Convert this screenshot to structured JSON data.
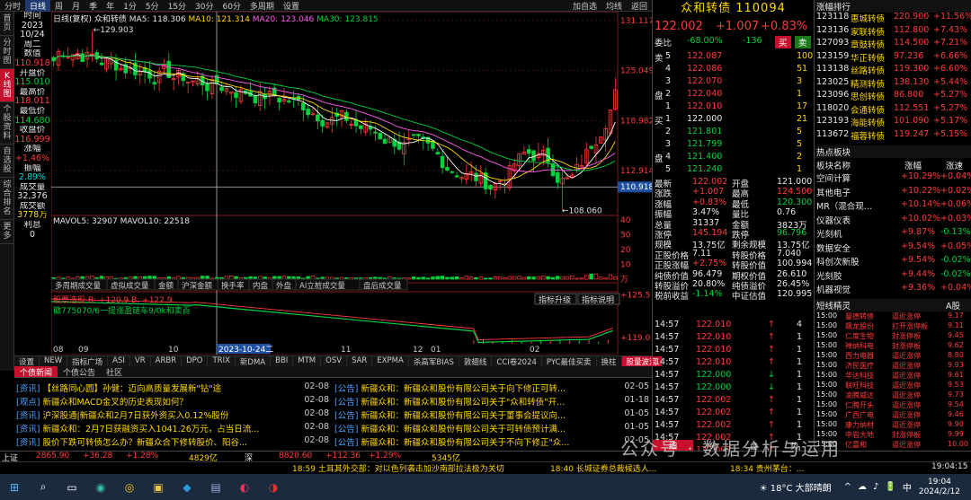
{
  "topbar": {
    "items": [
      "分时",
      "日线",
      "周",
      "月",
      "季",
      "年",
      "1分",
      "5分",
      "15分",
      "30分",
      "60分",
      "多周期",
      "设置"
    ],
    "active": 1,
    "right": [
      "加自选",
      "均线",
      "返回"
    ]
  },
  "lefttabs": [
    "首页",
    "分时图",
    "K线图",
    "个股资料",
    "自选股",
    "综合排名",
    "更多"
  ],
  "lefttab_active": 2,
  "infocol": [
    [
      "时间",
      "wht"
    ],
    [
      "2023",
      "wht"
    ],
    [
      "10/24",
      "wht"
    ],
    [
      "周二",
      "wht"
    ],
    [
      "数值",
      "wht"
    ],
    [
      "110.918",
      "red"
    ],
    [
      "开盘价",
      "wht"
    ],
    [
      "115.010",
      "grn"
    ],
    [
      "最高价",
      "wht"
    ],
    [
      "118.011",
      "red"
    ],
    [
      "最低价",
      "wht"
    ],
    [
      "114.680",
      "grn"
    ],
    [
      "收盘价",
      "wht"
    ],
    [
      "116.999",
      "red"
    ],
    [
      "涨幅",
      "wht"
    ],
    [
      "+1.46%",
      "red"
    ],
    [
      "振幅",
      "wht"
    ],
    [
      "2.89%",
      "cyn"
    ],
    [
      "成交量",
      "wht"
    ],
    [
      "32,376",
      "wht"
    ],
    [
      "成交额",
      "wht"
    ],
    [
      "3778万",
      "yel"
    ],
    [
      "利息",
      "wht"
    ],
    [
      "0",
      "wht"
    ]
  ],
  "legend": {
    "name": "众和转债",
    "ma5": "MA5: 118.306",
    "ma10": "MA10: 121.314",
    "ma20": "MA20: 123.046",
    "ma30": "MA30: 123.815",
    "rt": "日线(复权)"
  },
  "axis_right": [
    "131.117",
    "125.049",
    "118.982",
    "112.914",
    "110.918"
  ],
  "hi_label": "129.903",
  "lo_label": "108.060",
  "vol_legend": {
    "a": "MAVOL5: 32907",
    "b": "MAVOL10: 22518"
  },
  "vol_axis": [
    "40",
    "30",
    "20",
    "10",
    "万"
  ],
  "sub_tabs": [
    "多周期成交量",
    "虚拟成交量",
    "金额",
    "沪深金额",
    "换手率",
    "内盘",
    "外盘",
    "AI立桩成交量",
    "盘后成交量"
  ],
  "ind_legend": "股票选股 B: +120.9 B: +122.9",
  "ind_text": "徽775070/6一提涨盈链车9/0k和卖百",
  "ind_buttons": [
    "指标升级",
    "指标说明"
  ],
  "ind_axis": [
    "+125.5",
    "+119.0"
  ],
  "x_axis": [
    "08",
    "09",
    "10",
    "2023-10-24二",
    "11",
    "12",
    "01",
    "02"
  ],
  "indtabs": [
    "设置",
    "NEW",
    "指标广场",
    "ASI",
    "VR",
    "ARBR",
    "DPO",
    "TRIX",
    "新DMA",
    "BBI",
    "MTM",
    "OSV",
    "SAR",
    "EXPMA",
    "杀高军BIAS",
    "敦翅线",
    "CCI卷2024",
    "PYC最佳买卖",
    "换柱",
    "股量波浪"
  ],
  "newstabs": [
    "个债新闻",
    "个债公告",
    "社区"
  ],
  "news_left": [
    [
      "资讯",
      "【丝路同心圆】孙健：迈向高质量发展新\"钻\"途",
      "02-08"
    ],
    [
      "观点",
      "新疆众和MACD金叉的历史表现如何？",
      "02-08"
    ],
    [
      "资讯",
      "沪深股通|新疆众和2月7日获外资买入0.12%股份",
      "02-08"
    ],
    [
      "资讯",
      "新疆众和：2月7日获融资买入1041.26万元，占当日流...",
      "02-08"
    ],
    [
      "资讯",
      "股价下跌可转债怎么办？新疆众合下修转股价、阳谷...",
      "02-08"
    ]
  ],
  "news_right": [
    [
      "公告",
      "新疆众和：新疆众和股份有限公司关于向下修正可转...",
      "02-05"
    ],
    [
      "公告",
      "新疆众和：新疆众和股份有限公司关于\"众和转债\"开...",
      "01-18"
    ],
    [
      "公告",
      "新疆众和：新疆众和股份有限公司关于董事会提议向...",
      "01-05"
    ],
    [
      "公告",
      "新疆众和：新疆众和股份有限公司关于可转债预计满...",
      "01-05"
    ],
    [
      "公告",
      "新疆众和：新疆众和股份有限公司关于不向下修正\"众...",
      "02-05"
    ]
  ],
  "quote": {
    "title": "众和转债 110094",
    "price": "122.002",
    "chg": "+1.007",
    "pct": "+0.83%",
    "wb_label": "委比",
    "wb": "-68.00%",
    "wc": "-136",
    "sells": [
      [
        "卖",
        "5",
        "122.087",
        "100"
      ],
      [
        "",
        "4",
        "122.086",
        "51"
      ],
      [
        "",
        "3",
        "122.070",
        "3"
      ],
      [
        "盘",
        "2",
        "122.040",
        "1"
      ],
      [
        "",
        "1",
        "122.010",
        "17"
      ]
    ],
    "buys": [
      [
        "买",
        "1",
        "122.000",
        "21"
      ],
      [
        "",
        "2",
        "121.801",
        "5"
      ],
      [
        "",
        "3",
        "121.799",
        "5"
      ],
      [
        "盘",
        "4",
        "121.400",
        "2"
      ],
      [
        "",
        "5",
        "121.240",
        "1"
      ]
    ],
    "stats": [
      [
        "最新",
        "122.002",
        "开盘",
        "121.000"
      ],
      [
        "涨跌",
        "+1.007",
        "最高",
        "124.500"
      ],
      [
        "涨幅",
        "+0.83%",
        "最低",
        "120.300"
      ],
      [
        "振幅",
        "3.47%",
        "量比",
        "0.76"
      ],
      [
        "总量",
        "31337",
        "金额",
        "3823万"
      ],
      [
        "涨停",
        "145.194",
        "跌停",
        "96.796"
      ],
      [
        "规模",
        "13.75亿",
        "剩余规模",
        "13.75亿"
      ],
      [
        "正股价格",
        "7.11",
        "转股价格",
        "7.040"
      ],
      [
        "正股涨幅",
        "+2.75%",
        "转股价值",
        "100.994"
      ],
      [
        "纯债价值",
        "96.479",
        "期权价值",
        "26.610"
      ],
      [
        "转股溢价",
        "20.80%",
        "纯债溢价",
        "26.45%"
      ],
      [
        "税前收益",
        "-1.14%",
        "中证估值",
        "120.995"
      ]
    ],
    "trades": [
      [
        "14:57",
        "122.010",
        "4",
        "up"
      ],
      [
        "14:57",
        "122.010",
        "1",
        "up"
      ],
      [
        "14:57",
        "122.010",
        "1",
        "up"
      ],
      [
        "14:57",
        "122.010",
        "1",
        "up"
      ],
      [
        "14:57",
        "122.000",
        "1",
        "dn"
      ],
      [
        "14:57",
        "122.000",
        "1",
        "dn"
      ],
      [
        "14:57",
        "122.002",
        "1",
        "up"
      ],
      [
        "14:57",
        "122.002",
        "1",
        "up"
      ],
      [
        "14:57",
        "122.002",
        "1",
        "up"
      ],
      [
        "14:57",
        "122.002",
        "1",
        "up"
      ],
      [
        "15:00",
        "122.002",
        "1",
        "up"
      ]
    ],
    "bottom_tabs": [
      "细",
      "分",
      "盘",
      "势"
    ]
  },
  "rlist": {
    "title": "涨幅排行",
    "rows": [
      [
        "123118",
        "惠城转债",
        "220.900",
        "+11.56%"
      ],
      [
        "123136",
        "家联转债",
        "112.800",
        "+7.43%"
      ],
      [
        "127093",
        "章鼓转债",
        "114.500",
        "+7.21%"
      ],
      [
        "123159",
        "华正转债",
        "97.236",
        "+6.66%"
      ],
      [
        "113138",
        "丝路转债",
        "119.300",
        "+6.60%"
      ],
      [
        "123025",
        "精测转债",
        "138.130",
        "+5.44%"
      ],
      [
        "123096",
        "思创转债",
        "86.800",
        "+5.27%"
      ],
      [
        "118020",
        "会通转债",
        "112.551",
        "+5.27%"
      ],
      [
        "123193",
        "海能转债",
        "101.090",
        "+5.17%"
      ],
      [
        "113672",
        "福蓉转债",
        "119.247",
        "+5.15%"
      ]
    ],
    "hot_title": "热点板块",
    "hot_head": [
      "板块名称",
      "涨幅",
      "涨速"
    ],
    "hot": [
      [
        "空间计算",
        "+10.29%",
        "+0.04%"
      ],
      [
        "其他电子",
        "+10.22%",
        "+0.02%"
      ],
      [
        "MR（混合现...",
        "+10.14%",
        "+0.06%"
      ],
      [
        "仪器仪表",
        "+10.02%",
        "+0.03%"
      ],
      [
        "光刻机",
        "+9.87%",
        "-0.13%"
      ],
      [
        "数据安全",
        "+9.54%",
        "+0.05%"
      ],
      [
        "科创次新股",
        "+9.54%",
        "-0.02%"
      ],
      [
        "光刻胶",
        "+9.44%",
        "-0.02%"
      ],
      [
        "机器视觉",
        "+9.36%",
        "+0.04%"
      ]
    ],
    "short_title": "短线精灵",
    "short_tab": "A股",
    "short": [
      [
        "15:00",
        "曼德转债",
        "逼近涨停",
        "9.17"
      ],
      [
        "15:00",
        "飙龙股份",
        "打开涨停板",
        "9.11"
      ],
      [
        "15:00",
        "仁度生物",
        "封涨停板",
        "9.45"
      ],
      [
        "15:00",
        "禅纳科电",
        "封涨停板",
        "9.62"
      ],
      [
        "15:00",
        "西力电器",
        "逼近涨停",
        "8.80"
      ],
      [
        "15:00",
        "济民医疗",
        "逼近涨停",
        "9.93"
      ],
      [
        "15:00",
        "华达科技",
        "逼近涨停",
        "9.61"
      ],
      [
        "15:00",
        "联旺科技",
        "逼近涨停",
        "9.53"
      ],
      [
        "15:00",
        "凌腾威达",
        "逼近涨停",
        "9.73"
      ],
      [
        "15:00",
        "仁腾开头",
        "逼近涨停",
        "9.54"
      ],
      [
        "15:00",
        "广西广电",
        "逼近涨停",
        "9.46"
      ],
      [
        "15:00",
        "康力纳材",
        "逼近涨停",
        "9.90"
      ],
      [
        "15:00",
        "中岩大地",
        "封涨停板",
        "9.99"
      ],
      [
        "15:00",
        "亿嘉和",
        "逼近涨停",
        "10.00"
      ]
    ]
  },
  "ticker": [
    [
      "上证",
      "2865.90",
      "+36.28",
      "+1.28%",
      "4829亿"
    ],
    [
      "深",
      "8820.60",
      "+112.36",
      "+1.29%",
      "5345亿"
    ]
  ],
  "scroll": [
    "18:59 土耳其外交部：对以色列袭击加沙南部拉法极为关切",
    "18:40 长城证券总裁候选人...",
    "18:34 贵州茅台：...",
    "19:04:15"
  ],
  "watermark": "公众号 · 数据分析与运用",
  "taskbar": {
    "weather": "18°C 大部晴朗",
    "time": "19:04",
    "date": "2024/2/12",
    "lang": "中"
  },
  "colors": {
    "up": "#ff3b3b",
    "down": "#00d23c",
    "ma5": "#ffffff",
    "ma10": "#ffd800",
    "ma20": "#ff5cf0",
    "ma30": "#00d23c"
  }
}
